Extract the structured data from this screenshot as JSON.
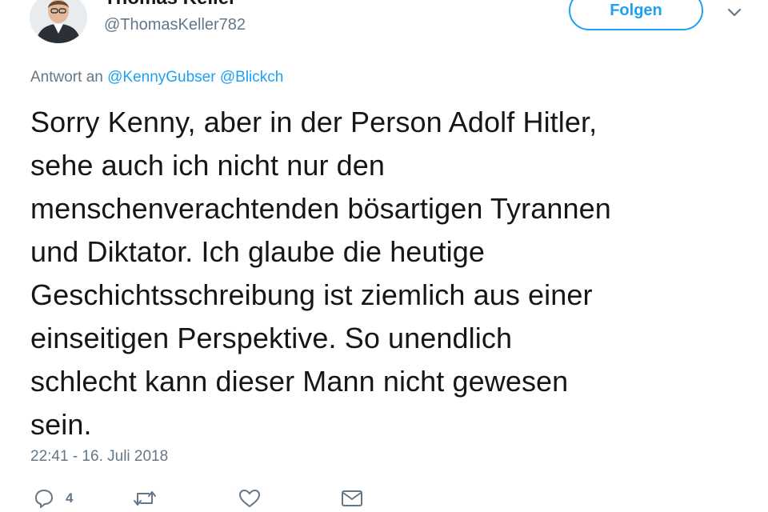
{
  "author": {
    "display_name": "Thomas Keller",
    "handle": "@ThomasKeller782"
  },
  "follow_button": {
    "label": "Folgen"
  },
  "reply_context": {
    "prefix": "Antwort an",
    "mentions": [
      "@KennyGubser",
      "@Blickch"
    ]
  },
  "tweet": {
    "lines": [
      "Sorry Kenny, aber in der Person Adolf Hitler,",
      "sehe auch ich nicht nur den",
      "menschenverachtenden bösartigen Tyrannen",
      "und Diktator. Ich glaube die heutige",
      "Geschichtsschreibung ist ziemlich aus einer",
      "einseitigen Perspektive. So unendlich",
      "schlecht kann dieser Mann nicht gewesen",
      "sein."
    ],
    "timestamp": "22:41 - 16. Juli 2018"
  },
  "actions": {
    "reply_count": "4",
    "reply_icon": "reply-icon",
    "retweet_icon": "retweet-icon",
    "like_icon": "heart-icon",
    "message_icon": "envelope-icon"
  },
  "colors": {
    "accent": "#1da1f2",
    "text": "#14171a",
    "muted": "#657786"
  }
}
